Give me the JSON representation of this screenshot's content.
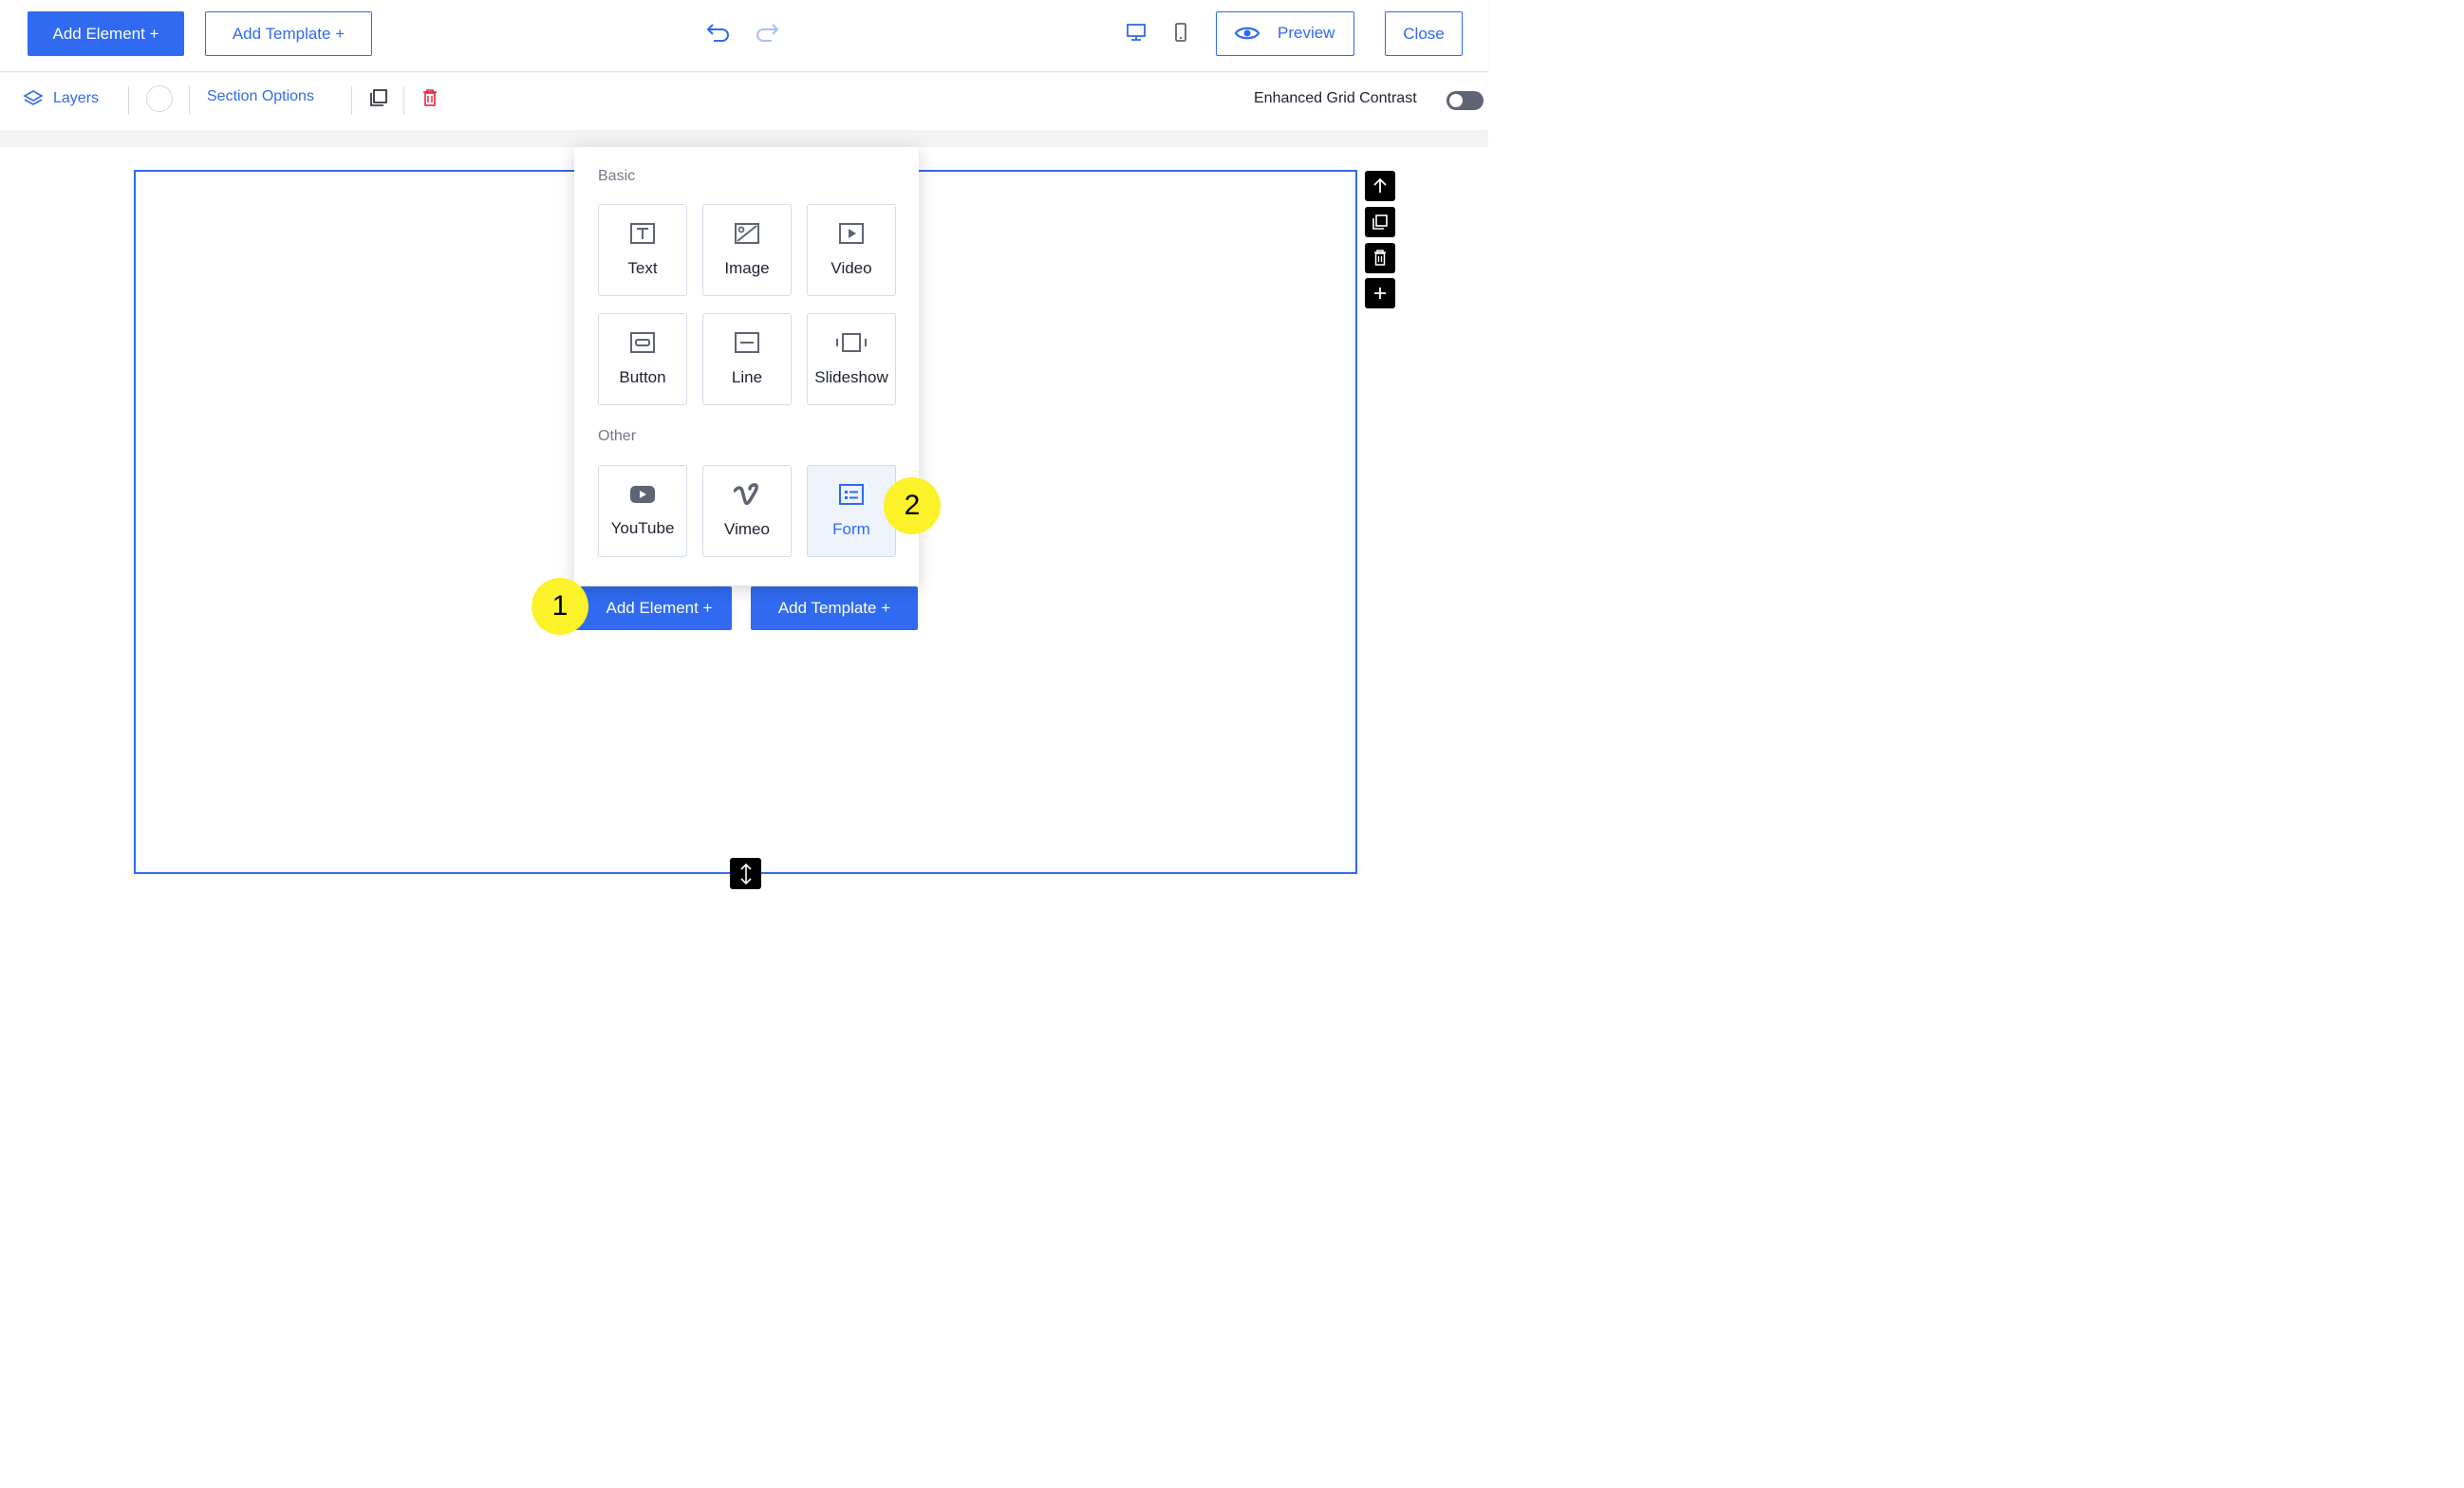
{
  "topbar": {
    "add_element_label": "Add Element +",
    "add_template_label": "Add Template +",
    "undo_icon": "undo-icon",
    "redo_icon": "redo-icon",
    "desktop_icon": "desktop-icon",
    "mobile_icon": "mobile-icon",
    "preview_label": "Preview",
    "close_label": "Close"
  },
  "toolbar": {
    "layers_label": "Layers",
    "section_options_label": "Section Options",
    "enhanced_grid_label": "Enhanced Grid Contrast",
    "enhanced_grid_on": false
  },
  "popup": {
    "basic_label": "Basic",
    "other_label": "Other",
    "basic_items": [
      {
        "label": "Text",
        "icon": "text-icon"
      },
      {
        "label": "Image",
        "icon": "image-icon"
      },
      {
        "label": "Video",
        "icon": "video-icon"
      },
      {
        "label": "Button",
        "icon": "button-icon"
      },
      {
        "label": "Line",
        "icon": "line-icon"
      },
      {
        "label": "Slideshow",
        "icon": "slideshow-icon"
      }
    ],
    "other_items": [
      {
        "label": "YouTube",
        "icon": "youtube-icon"
      },
      {
        "label": "Vimeo",
        "icon": "vimeo-icon"
      },
      {
        "label": "Form",
        "icon": "form-icon",
        "active": true
      }
    ]
  },
  "canvas": {
    "add_element_label": "Add Element +",
    "add_template_label": "Add Template +"
  },
  "badges": {
    "step1": "1",
    "step2": "2"
  },
  "colors": {
    "accent": "#2f6af0",
    "delete": "#e5243b",
    "badge": "#fbf229"
  }
}
